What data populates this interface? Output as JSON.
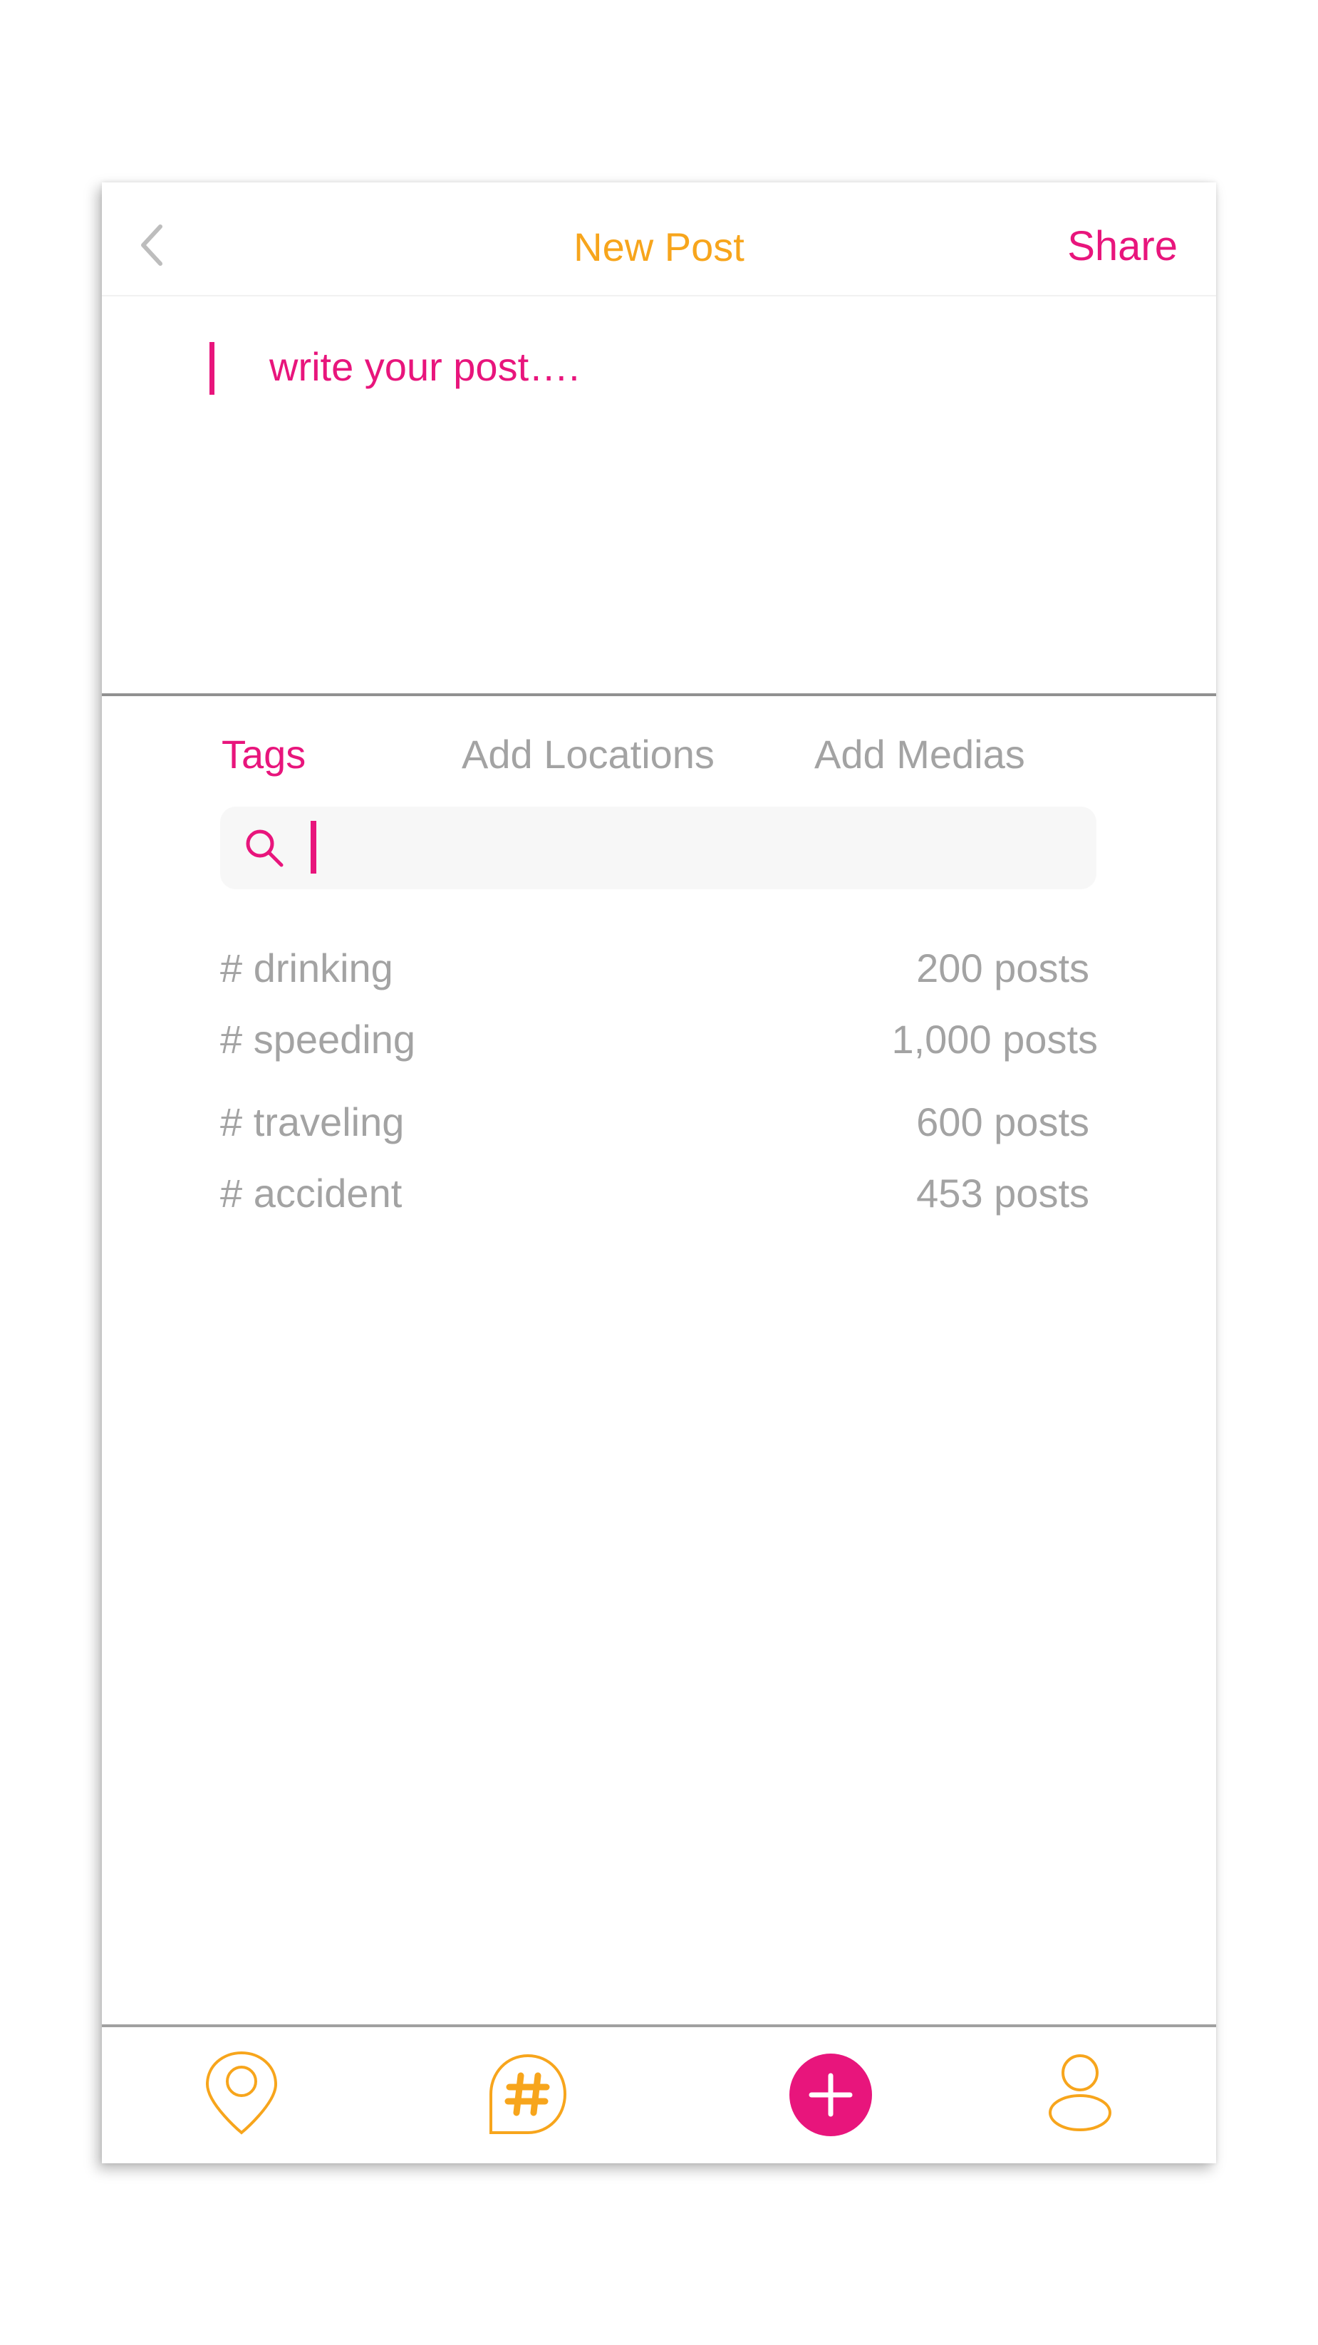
{
  "header": {
    "title": "New Post",
    "share_label": "Share",
    "back_icon": "chevron-left-icon"
  },
  "compose": {
    "placeholder": "write your post…."
  },
  "tabs": [
    {
      "label": "Tags",
      "active": true
    },
    {
      "label": "Add Locations",
      "active": false
    },
    {
      "label": "Add Medias",
      "active": false
    }
  ],
  "search": {
    "value": "",
    "icon": "search-icon"
  },
  "tags": [
    {
      "name": "# drinking",
      "count": "200 posts"
    },
    {
      "name": "# speeding",
      "count": "1,000 posts"
    },
    {
      "name": "# traveling",
      "count": "600 posts"
    },
    {
      "name": "# accident",
      "count": "453 posts"
    }
  ],
  "bottom_nav": [
    {
      "icon": "location-pin-icon"
    },
    {
      "icon": "hashtag-chat-icon"
    },
    {
      "icon": "add-post-icon"
    },
    {
      "icon": "profile-icon"
    }
  ],
  "colors": {
    "accent_pink": "#e8157c",
    "accent_orange": "#f7a51c",
    "muted_text": "#a3a3a3"
  }
}
